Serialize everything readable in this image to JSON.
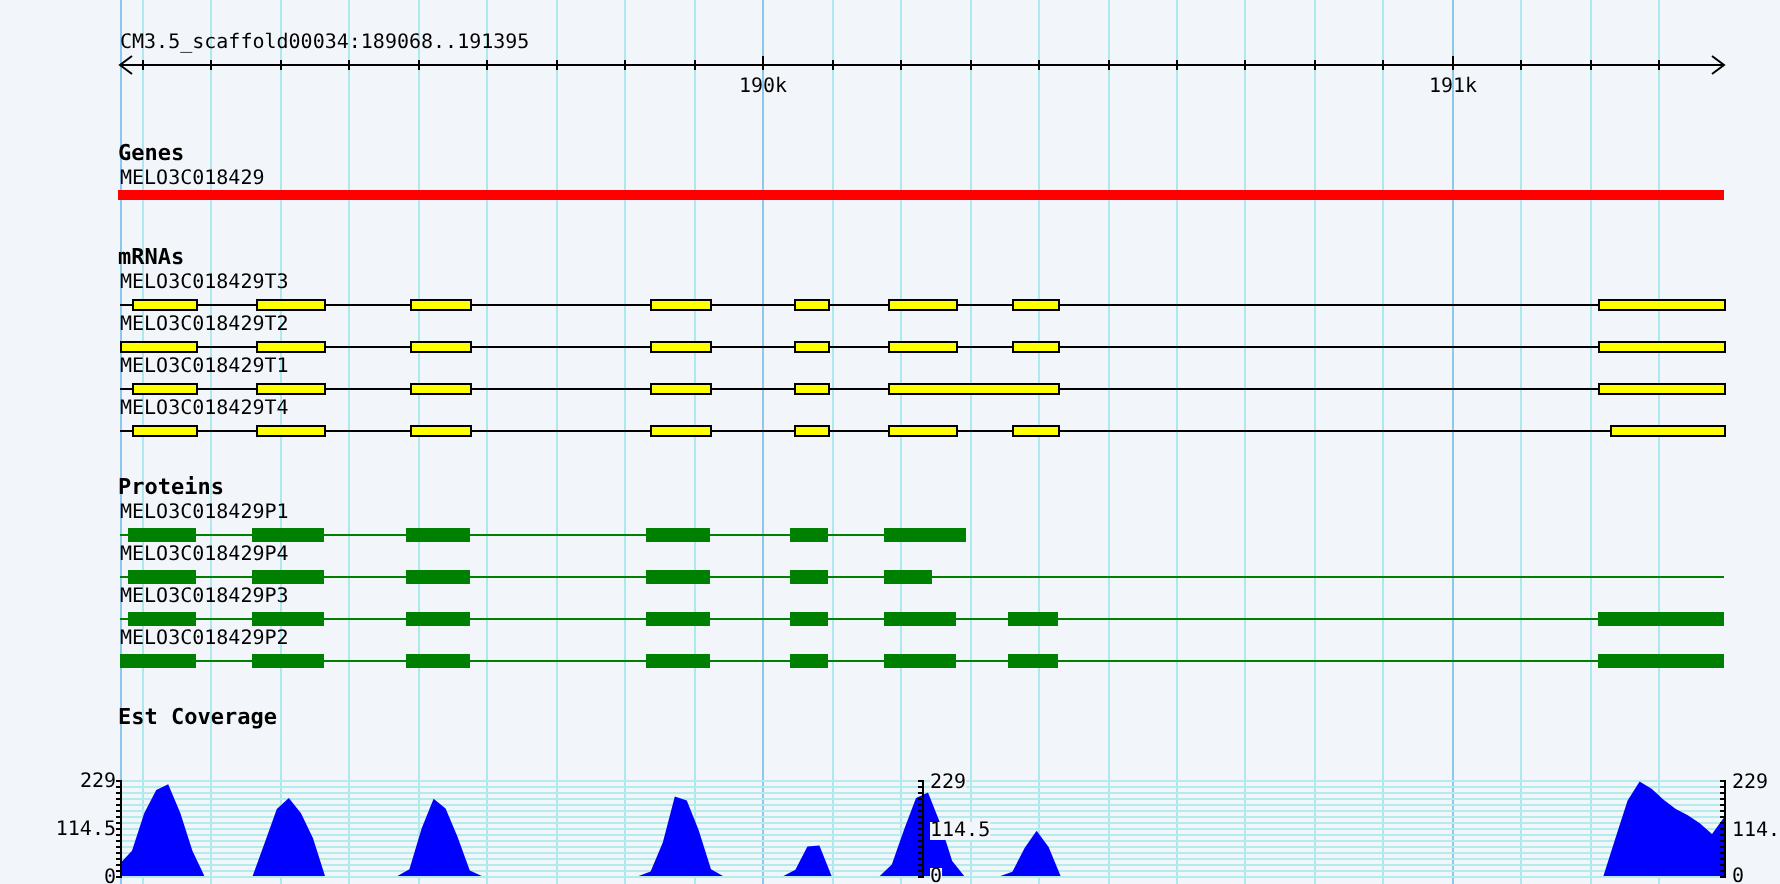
{
  "ruler": {
    "label": "CM3.5_scaffold00034:189068..191395",
    "ticks": [
      {
        "label": "190k"
      },
      {
        "label": "191k"
      }
    ]
  },
  "tracks": [
    {
      "kind": "gene",
      "title": "Genes",
      "features": [
        {
          "label": "MELO3C018429"
        }
      ]
    },
    {
      "kind": "mrna",
      "title": "mRNAs",
      "features": [
        {
          "label": "MELO3C018429T3"
        },
        {
          "label": "MELO3C018429T2"
        },
        {
          "label": "MELO3C018429T1"
        },
        {
          "label": "MELO3C018429T4"
        }
      ]
    },
    {
      "kind": "protein",
      "title": "Proteins",
      "features": [
        {
          "label": "MELO3C018429P1"
        },
        {
          "label": "MELO3C018429P4"
        },
        {
          "label": "MELO3C018429P3"
        },
        {
          "label": "MELO3C018429P2"
        }
      ]
    },
    {
      "kind": "coverage",
      "title": "Est Coverage",
      "axes": [
        {
          "ticks": [
            "229",
            "114.5",
            "0"
          ]
        },
        {
          "ticks": [
            "229",
            "114.",
            "0"
          ]
        }
      ],
      "chart_data": {
        "type": "area",
        "grid": true,
        "categories": [
          null,
          null,
          null,
          null,
          null,
          null,
          null,
          null,
          null,
          null,
          null,
          null,
          null,
          null,
          null,
          null,
          null,
          null,
          null,
          null,
          null,
          null,
          null,
          null,
          null,
          null,
          null,
          null,
          null,
          null,
          null,
          null,
          null,
          null,
          null,
          null,
          null,
          null,
          null,
          null,
          null,
          null,
          null,
          null,
          null,
          null,
          null,
          null,
          null,
          null,
          null,
          null,
          null,
          null,
          null,
          null,
          null,
          null,
          null,
          null,
          null,
          null,
          null,
          null,
          null,
          null,
          null,
          null,
          null,
          null,
          null,
          null,
          null,
          null,
          null,
          null,
          null,
          null,
          null,
          null,
          null,
          null,
          null,
          null,
          null,
          null,
          null,
          null,
          null,
          null,
          null,
          null,
          null,
          null,
          null,
          null,
          null,
          null,
          null,
          null,
          null,
          null,
          null,
          null,
          null,
          null,
          null,
          null,
          null,
          null,
          null,
          null,
          null,
          null,
          null,
          null,
          null,
          null,
          null,
          null,
          null,
          null,
          null,
          null,
          null,
          null,
          null,
          null,
          null,
          null,
          null,
          null,
          null,
          null
        ],
        "series": [
          {
            "color": "#0000ff",
            "values": [
              30,
              60,
              150,
              205,
              219,
              150,
              60,
              0,
              0,
              0,
              0,
              0,
              80,
              160,
              186,
              150,
              90,
              0,
              0,
              0,
              0,
              0,
              0,
              0,
              16,
              113,
              184,
              161,
              93,
              13,
              0,
              0,
              0,
              0,
              0,
              0,
              0,
              0,
              0,
              0,
              0,
              0,
              0,
              0,
              11,
              80,
              190,
              180,
              109,
              16,
              0,
              0,
              0,
              0,
              0,
              0,
              15,
              70,
              73,
              0,
              0,
              0,
              0,
              0,
              27,
              110,
              186,
              199,
              127,
              36,
              0,
              0,
              0,
              0,
              10,
              67,
              108,
              69,
              0,
              0,
              0,
              0,
              0,
              0,
              0,
              0,
              0,
              0,
              0,
              0,
              0,
              0,
              0,
              0,
              0,
              0,
              0,
              0,
              0,
              0,
              0,
              0,
              0,
              0,
              0,
              0,
              0,
              0,
              0,
              0,
              0,
              0,
              0,
              0,
              0,
              0,
              0,
              0,
              0,
              0,
              0,
              0,
              0,
              0,
              90,
              180,
              225,
              208,
              182,
              160,
              145,
              126,
              100,
              140
            ]
          }
        ],
        "ylim": [
          0,
          229
        ],
        "yticks": [
          {
            "value": 229,
            "label": "229"
          },
          {
            "value": 114.5,
            "label": "114.5"
          },
          {
            "value": 0,
            "label": "0"
          }
        ]
      }
    }
  ]
}
